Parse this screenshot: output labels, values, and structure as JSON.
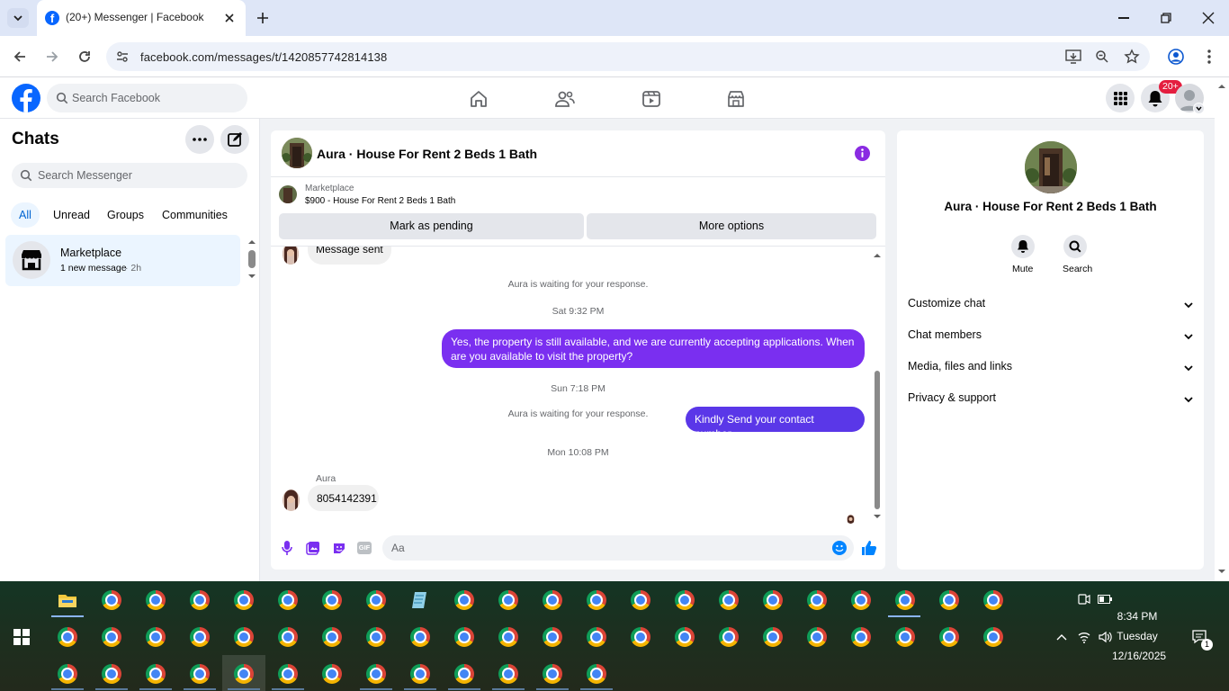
{
  "browser": {
    "tab_title": "(20+) Messenger | Facebook",
    "url": "facebook.com/messages/t/1420857742814138"
  },
  "fb_header": {
    "search_placeholder": "Search Facebook",
    "notification_badge": "20+"
  },
  "sidebar": {
    "title": "Chats",
    "search_placeholder": "Search Messenger",
    "filters": [
      "All",
      "Unread",
      "Groups",
      "Communities"
    ],
    "conversations": [
      {
        "name": "Marketplace",
        "preview": "1 new message",
        "time": "· 2h"
      }
    ]
  },
  "chat": {
    "title": "Aura · House For Rent 2 Beds 1 Bath",
    "listing": {
      "source": "Marketplace",
      "price_title": "$900 - House For Rent 2 Beds 1 Bath",
      "mark_pending": "Mark as pending",
      "more_options": "More options"
    },
    "messages": {
      "partial_in": "Message sent",
      "waiting_notice": "Aura is waiting for your response.",
      "ts1": "Sat 9:32 PM",
      "out1": "Yes, the property is still available, and we are currently accepting applications. When are you available to visit the property?",
      "ts2": "Sun 7:18 PM",
      "out2": "Kindly Send your contact number.",
      "ts3": "Mon 10:08 PM",
      "sender_name": "Aura",
      "in1": "8054142391"
    },
    "composer_placeholder": "Aa"
  },
  "info_panel": {
    "title": "Aura · House For Rent 2 Beds 1 Bath",
    "mute_label": "Mute",
    "search_label": "Search",
    "sections": [
      "Customize chat",
      "Chat members",
      "Media, files and links",
      "Privacy & support"
    ]
  },
  "taskbar": {
    "time": "8:34 PM",
    "day": "Tuesday",
    "date": "12/16/2025",
    "notification_count": "1"
  },
  "colors": {
    "messenger_purple": "#7a2ff0",
    "fb_blue": "#0866ff",
    "notification_red": "#e41e3f"
  }
}
